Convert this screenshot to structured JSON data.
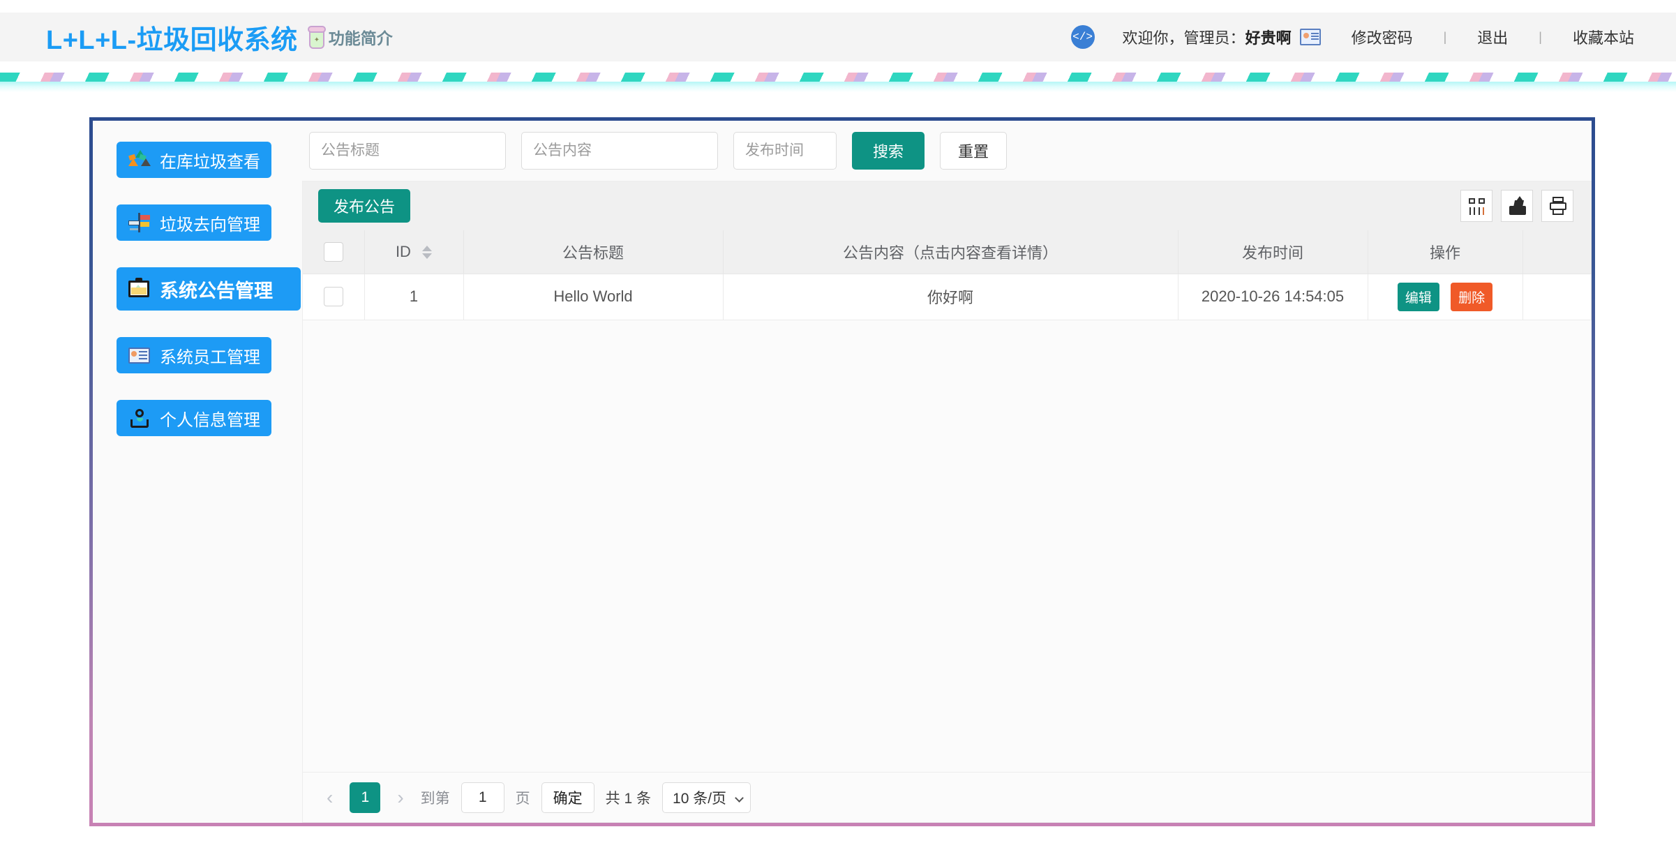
{
  "header": {
    "brand_title": "L+L+L-垃圾回收系统",
    "brand_sub": "功能简介",
    "cup_icon": "trash-cup-icon",
    "code_badge": "</>",
    "welcome_prefix": "欢迎你，管理员：",
    "welcome_user": "好贵啊",
    "idcard_icon": "id-card-icon",
    "links": [
      {
        "label": "修改密码"
      },
      {
        "label": "退出"
      },
      {
        "label": "收藏本站"
      }
    ],
    "separator": "|"
  },
  "sidebar": {
    "items": [
      {
        "label": "在库垃圾查看",
        "icon": "recycle-icon",
        "active": false
      },
      {
        "label": "垃圾去向管理",
        "icon": "signpost-icon",
        "active": false
      },
      {
        "label": "系统公告管理",
        "icon": "picture-board-icon",
        "active": true
      },
      {
        "label": "系统员工管理",
        "icon": "id-card-icon",
        "active": false
      },
      {
        "label": "个人信息管理",
        "icon": "person-icon",
        "active": false
      }
    ]
  },
  "search": {
    "title_placeholder": "公告标题",
    "title_value": "",
    "content_placeholder": "公告内容",
    "content_value": "",
    "date_placeholder": "发布时间",
    "date_value": "",
    "search_label": "搜索",
    "reset_label": "重置"
  },
  "toolbar": {
    "publish_label": "发布公告",
    "icons": [
      {
        "name": "columns-toggle-icon"
      },
      {
        "name": "export-icon"
      },
      {
        "name": "print-icon"
      }
    ]
  },
  "table": {
    "columns": [
      {
        "key": "checkbox",
        "label": ""
      },
      {
        "key": "id",
        "label": "ID",
        "sortable": true
      },
      {
        "key": "title",
        "label": "公告标题"
      },
      {
        "key": "content",
        "label": "公告内容（点击内容查看详情）"
      },
      {
        "key": "time",
        "label": "发布时间"
      },
      {
        "key": "action",
        "label": "操作"
      },
      {
        "key": "spacer",
        "label": ""
      }
    ],
    "rows": [
      {
        "id": "1",
        "title": "Hello World",
        "content": "你好啊",
        "time": "2020-10-26 14:54:05",
        "edit_label": "编辑",
        "delete_label": "删除"
      }
    ]
  },
  "pager": {
    "prev": "‹",
    "next": "›",
    "current_page": "1",
    "goto_prefix": "到第",
    "goto_value": "1",
    "goto_suffix": "页",
    "confirm_label": "确定",
    "total_text": "共 1 条",
    "page_size": "10 条/页"
  },
  "colors": {
    "brand_blue": "#1b9cf5",
    "sidebar_blue": "#1d9bf5",
    "teal": "#0e9384",
    "danger_orange": "#f05a28",
    "frame_top": "#2b4b8f",
    "frame_bottom": "#c781b4"
  }
}
